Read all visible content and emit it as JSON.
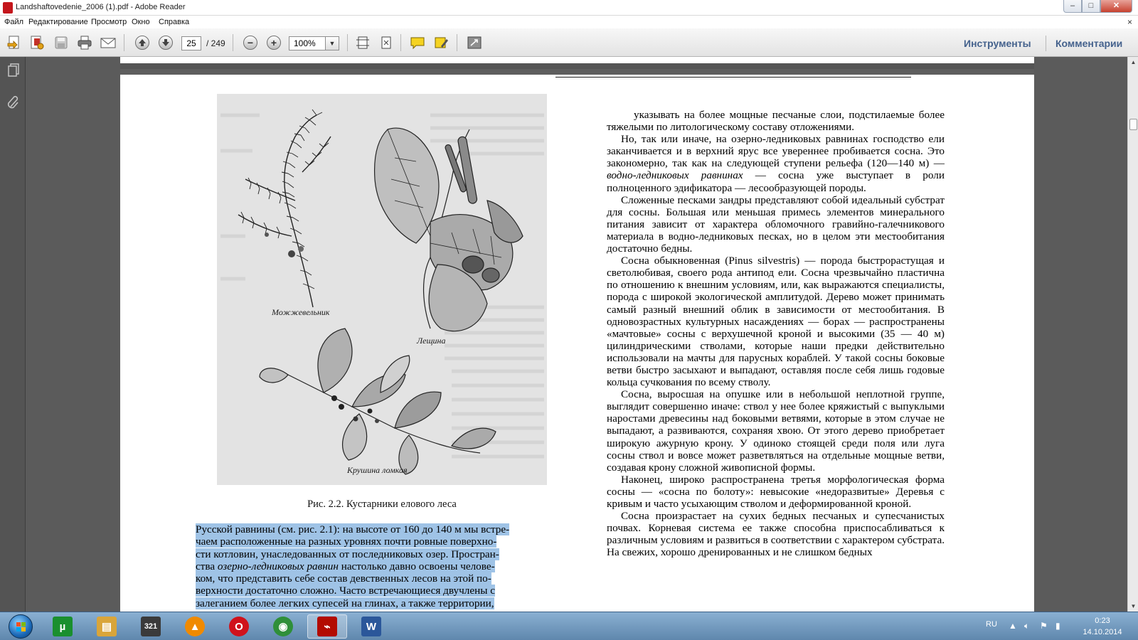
{
  "window": {
    "title": "Landshaftovedenie_2006 (1).pdf - Adobe Reader",
    "min_symbol": "–",
    "max_symbol": "□",
    "close_symbol": "✕"
  },
  "menu": {
    "items": [
      "Файл",
      "Редактирование",
      "Просмотр",
      "Окно",
      "Справка"
    ],
    "close_symbol": "×"
  },
  "toolbar": {
    "page_current": "25",
    "page_total": "/ 249",
    "zoom": "100%",
    "zoom_out_symbol": "−",
    "zoom_in_symbol": "+",
    "dropdown_symbol": "▼",
    "tools_label": "Инструменты",
    "comments_label": "Комментарии"
  },
  "document": {
    "figure": {
      "caption": "Рис. 2.2. Кустарники елового леса",
      "labels": {
        "juniper": "Можжевельник",
        "hazel": "Лещина",
        "buckthorn": "Крушина ломкая"
      }
    },
    "left_column": {
      "lines": [
        "Русской равнины (см. рис. 2.1): на высоте от 160 до 140 м мы встре-",
        "чаем расположенные на разных уровнях почти ровные поверхно-",
        "сти котловин, унаследованных от последниковых озер. Простран-",
        "ства",
        "озерно-ледниковых равнин",
        "настолько давно освоены челове-",
        "ком, что представить себе состав девственных лесов на этой по-",
        "верхности достаточно сложно. Часто встречающиеся двучлены с",
        "залеганием более легких супесей на глинах, а также территории,"
      ]
    },
    "right_column": {
      "paragraphs": [
        "указывать на более мощные песчаные слои, подстилаемые более тяжелыми по литологическому составу отложениями.",
        "Но, так или иначе, на озерно-ледниковых равнинах господство ели заканчивается и в верхний ярус все увереннее пробивается сосна. Это закономерно, так как на следующей ступени рельефа (120—140 м) —",
        "водно-ледниковых равнинах",
        "— сосна уже выступает в роли полноценного эдификатора — лесообразующей породы.",
        "Сложенные песками зандры представляют собой идеальный субстрат для сосны. Большая или меньшая примесь элементов минерального питания зависит от характера обломочного гравийно-галечникового материала в водно-ледниковых песках, но в целом эти местообитания достаточно бедны.",
        "Сосна обыкновенная (Pinus silvestris) — порода быстрорастущая и светолюбивая, своего рода антипод ели. Сосна чрезвычайно пластична по отношению к внешним условиям, или, как выражаются специалисты, порода с широкой экологической амплитудой. Дерево может принимать самый разный внешний облик в зависимости от местообитания. В одновозрастных культурных насаждениях — борах — распространены «мачтовые» сосны с верхушечной кроной и высокими (35 — 40 м) цилиндрическими стволами, которые наши предки действительно использовали на мачты для парусных кораблей. У такой сосны боковые ветви быстро засыхают и выпадают, оставляя после себя лишь годовые кольца сучкования по всему стволу.",
        "Сосна, выросшая на опушке или в небольшой неплотной группе, выглядит совершенно иначе: ствол у нее более кряжистый с выпуклыми наростами древесины над боковыми ветвями, которые в этом случае не выпадают, а развиваются, сохраняя хвою. От этого дерево приобретает широкую ажурную крону. У одиноко стоящей среди поля или луга сосны ствол и вовсе может разветвляться на отдельные мощные ветви, создавая крону сложной живописной формы.",
        "Наконец, широко распространена третья морфологическая форма сосны — «сосна по болоту»: невысокие «недоразвитые» Деревья с кривым и часто усыхающим стволом и деформированной кроной.",
        "Сосна произрастает на сухих бедных песчаных и супесчанистых почвах. Корневая система ее также способна приспосабливаться к различным условиям и развиться в соответствии с характером субстрата. На свежих, хорошо дренированных и не слишком бедных"
      ]
    }
  },
  "taskbar": {
    "apps": [
      {
        "name": "utorrent",
        "glyph": "µ",
        "color": "#1a8f2e"
      },
      {
        "name": "explorer",
        "glyph": "▤",
        "color": "#d9a53a"
      },
      {
        "name": "media-player-classic",
        "glyph": "321",
        "color": "#3a3a3a"
      },
      {
        "name": "vlc",
        "glyph": "▲",
        "color": "#f08a00"
      },
      {
        "name": "opera",
        "glyph": "O",
        "color": "#d0121b"
      },
      {
        "name": "chrome",
        "glyph": "◉",
        "color": "#2f8f3a"
      },
      {
        "name": "adobe-reader",
        "glyph": "⌁",
        "color": "#b30b00"
      },
      {
        "name": "word",
        "glyph": "W",
        "color": "#2b579a"
      }
    ],
    "language": "RU",
    "time": "0:23",
    "date": "14.10.2014"
  }
}
